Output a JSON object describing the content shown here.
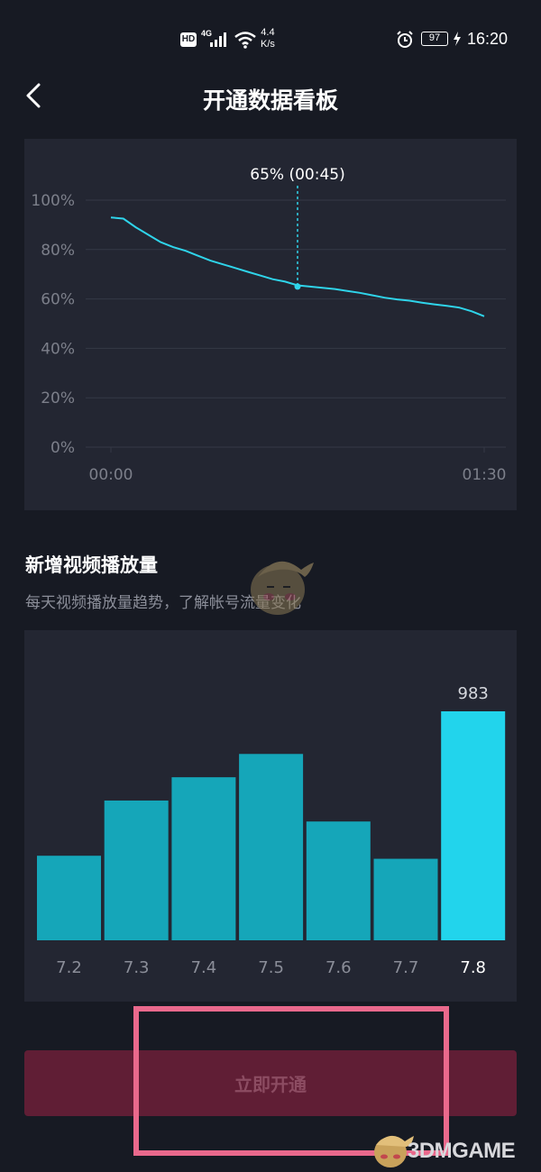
{
  "status_bar": {
    "hd_badge": "HD",
    "network": "4G",
    "speed_value": "4.4",
    "speed_unit": "K/s",
    "battery": "97",
    "time": "16:20"
  },
  "nav": {
    "title": "开通数据看板"
  },
  "retention_chart": {
    "tooltip": "65% (00:45)",
    "y_ticks": [
      "100%",
      "80%",
      "60%",
      "40%",
      "20%",
      "0%"
    ],
    "x_ticks": [
      "00:00",
      "01:30"
    ]
  },
  "section": {
    "title": "新增视频播放量",
    "subtitle": "每天视频播放量趋势，了解帐号流量变化"
  },
  "cta": {
    "label": "立即开通"
  },
  "watermark": {
    "text": "3DMGAME"
  },
  "colors": {
    "background": "#171a23",
    "panel": "#232632",
    "line": "#2fd4ea",
    "bar": "#15a6b9",
    "bar_highlight": "#22d4ec",
    "cta_bg": "#601e35",
    "cta_text": "#8c4c62",
    "highlight_border": "#e9698c"
  },
  "chart_data": [
    {
      "type": "line",
      "x": [
        0,
        3,
        6,
        9,
        12,
        15,
        18,
        21,
        24,
        27,
        30,
        33,
        36,
        39,
        42,
        45,
        48,
        51,
        54,
        57,
        60,
        63,
        66,
        69,
        72,
        75,
        78,
        81,
        84,
        87,
        90
      ],
      "x_unit": "seconds",
      "y": [
        93,
        92.5,
        89,
        86,
        83,
        81,
        79.5,
        77.5,
        75.5,
        74,
        72.5,
        71,
        69.5,
        68,
        67,
        65.5,
        65,
        64.5,
        64,
        63.2,
        62.5,
        61.5,
        60.5,
        59.8,
        59.3,
        58.5,
        57.8,
        57.2,
        56.5,
        55,
        53
      ],
      "highlight": {
        "x": 45,
        "y": 65,
        "label": "65% (00:45)"
      },
      "xlim": [
        0,
        90
      ],
      "ylim": [
        0,
        100
      ],
      "y_ticks": [
        100,
        80,
        60,
        40,
        20,
        0
      ],
      "x_ticks": [
        "00:00",
        "01:30"
      ],
      "grid": true
    },
    {
      "type": "bar",
      "categories": [
        "7.2",
        "7.3",
        "7.4",
        "7.5",
        "7.6",
        "7.7",
        "7.8"
      ],
      "values": [
        363,
        600,
        700,
        800,
        510,
        350,
        983
      ],
      "highlight_index": 6,
      "data_labels": [
        "",
        "",
        "",
        "",
        "",
        "",
        "983"
      ],
      "ylim": [
        0,
        983
      ]
    }
  ]
}
